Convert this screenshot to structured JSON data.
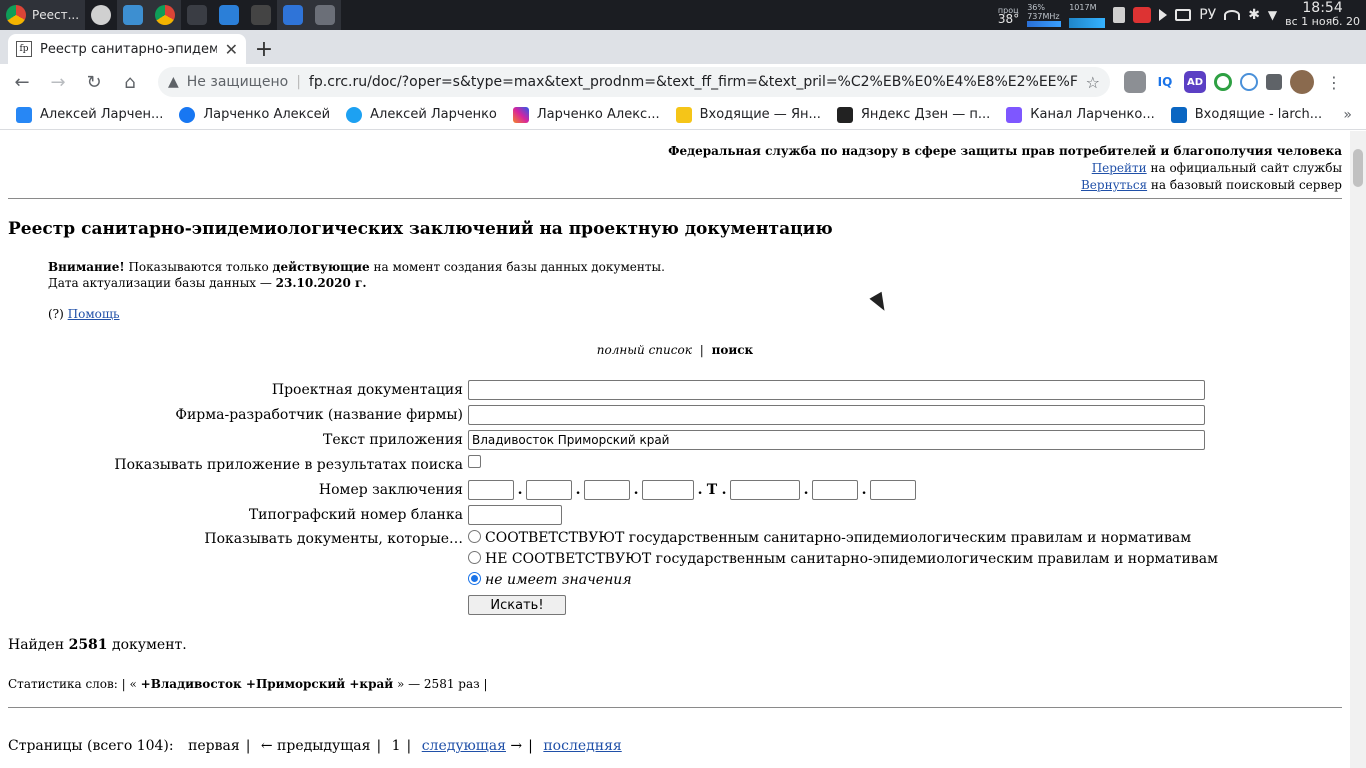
{
  "os": {
    "active_task_label": "Реест...",
    "tray": {
      "temp": "38°",
      "cpu_label": "проц",
      "cpu_percent": "36%",
      "freq": "737MHz",
      "mem": "1017M",
      "lang": "РУ"
    },
    "clock": {
      "time": "18:54",
      "date": "вс 1 нояб. 20"
    }
  },
  "browser": {
    "tab_title": "Реестр санитарно-эпидемио",
    "tab_favicon": "fp",
    "security_label": "Не защищено",
    "url": "fp.crc.ru/doc/?oper=s&type=max&text_prodnm=&text_ff_firm=&text_pril=%C2%EB%E0%E4%E8%E2%EE%F1%F2%EE%E...",
    "extensions": [
      {
        "name": "ext-photo",
        "color": "#8c8f94",
        "glyph": ""
      },
      {
        "name": "ext-iq",
        "color": "#ffffff",
        "glyph": "IQ"
      },
      {
        "name": "ext-ad",
        "color": "#5b3fc4",
        "glyph": "AD"
      },
      {
        "name": "ext-circle",
        "color": "#2ea043",
        "glyph": ""
      },
      {
        "name": "ext-sync",
        "color": "#4a90d9",
        "glyph": ""
      },
      {
        "name": "puzzle",
        "color": "#5f6368",
        "glyph": ""
      }
    ],
    "bookmarks": [
      {
        "label": "Алексей Ларчен...",
        "color": "#2787f5"
      },
      {
        "label": "Ларченко Алексей",
        "color": "#1877f2"
      },
      {
        "label": "Алексей Ларченко",
        "color": "#1da1f2"
      },
      {
        "label": "Ларченко Алекс...",
        "color": "#d6249f"
      },
      {
        "label": "Входящие — Ян...",
        "color": "#f5c518"
      },
      {
        "label": "Яндекс Дзен — п...",
        "color": "#222222"
      },
      {
        "label": "Канал Ларченко...",
        "color": "#7e57ff"
      },
      {
        "label": "Входящие - larch...",
        "color": "#0a66c2"
      }
    ]
  },
  "header": {
    "agency": "Федеральная служба по надзору в сфере защиты прав потребителей и благополучия человека",
    "link1": "Перейти",
    "link1_rest": " на официальный сайт службы",
    "link2": "Вернуться",
    "link2_rest": " на базовый поисковый сервер"
  },
  "title": "Реестр санитарно-эпидемиологических заключений на проектную документацию",
  "notice": {
    "warn_bold": "Внимание!",
    "warn_text1": " Показываются только ",
    "warn_bold2": "действующие",
    "warn_text2": " на момент создания базы данных документы.",
    "date_text": "Дата актуализации базы данных — ",
    "date_value": "23.10.2020 г."
  },
  "help": {
    "prefix": "(?) ",
    "link": "Помощь"
  },
  "modes": {
    "full": "полный список",
    "sep": "|",
    "search": "поиск"
  },
  "form": {
    "project_label": "Проектная документация",
    "project_value": "",
    "firm_label": "Фирма-разработчик (название фирмы)",
    "firm_value": "",
    "appendix_label": "Текст приложения",
    "appendix_value": "Владивосток Приморский край",
    "show_appendix_label": "Показывать приложение в результатах поиска",
    "number_label": "Номер заключения",
    "number_sep": ".",
    "number_t": "T",
    "blank_label": "Типографский номер бланка",
    "show_docs_label": "Показывать документы, которые…",
    "options": [
      "СООТВЕТСТВУЮТ государственным санитарно-эпидемиологическим правилам и нормативам",
      "НЕ СООТВЕТСТВУЮТ государственным санитарно-эпидемиологическим правилам и нормативам",
      "не имеет значения"
    ],
    "submit": "Искать!"
  },
  "results": {
    "found_prefix": "Найден ",
    "found_count": "2581",
    "found_suffix": " документ.",
    "stats_prefix": "Статистика слов: | « ",
    "stats_query": "+Владивосток +Приморский +край",
    "stats_suffix": " » — 2581 раз |"
  },
  "pagination": {
    "label": "Страницы (всего 104):",
    "first": "первая",
    "prev": "← предыдущая",
    "current": "1",
    "next": "следующая",
    "next_arrow": " →",
    "last": "последняя"
  }
}
